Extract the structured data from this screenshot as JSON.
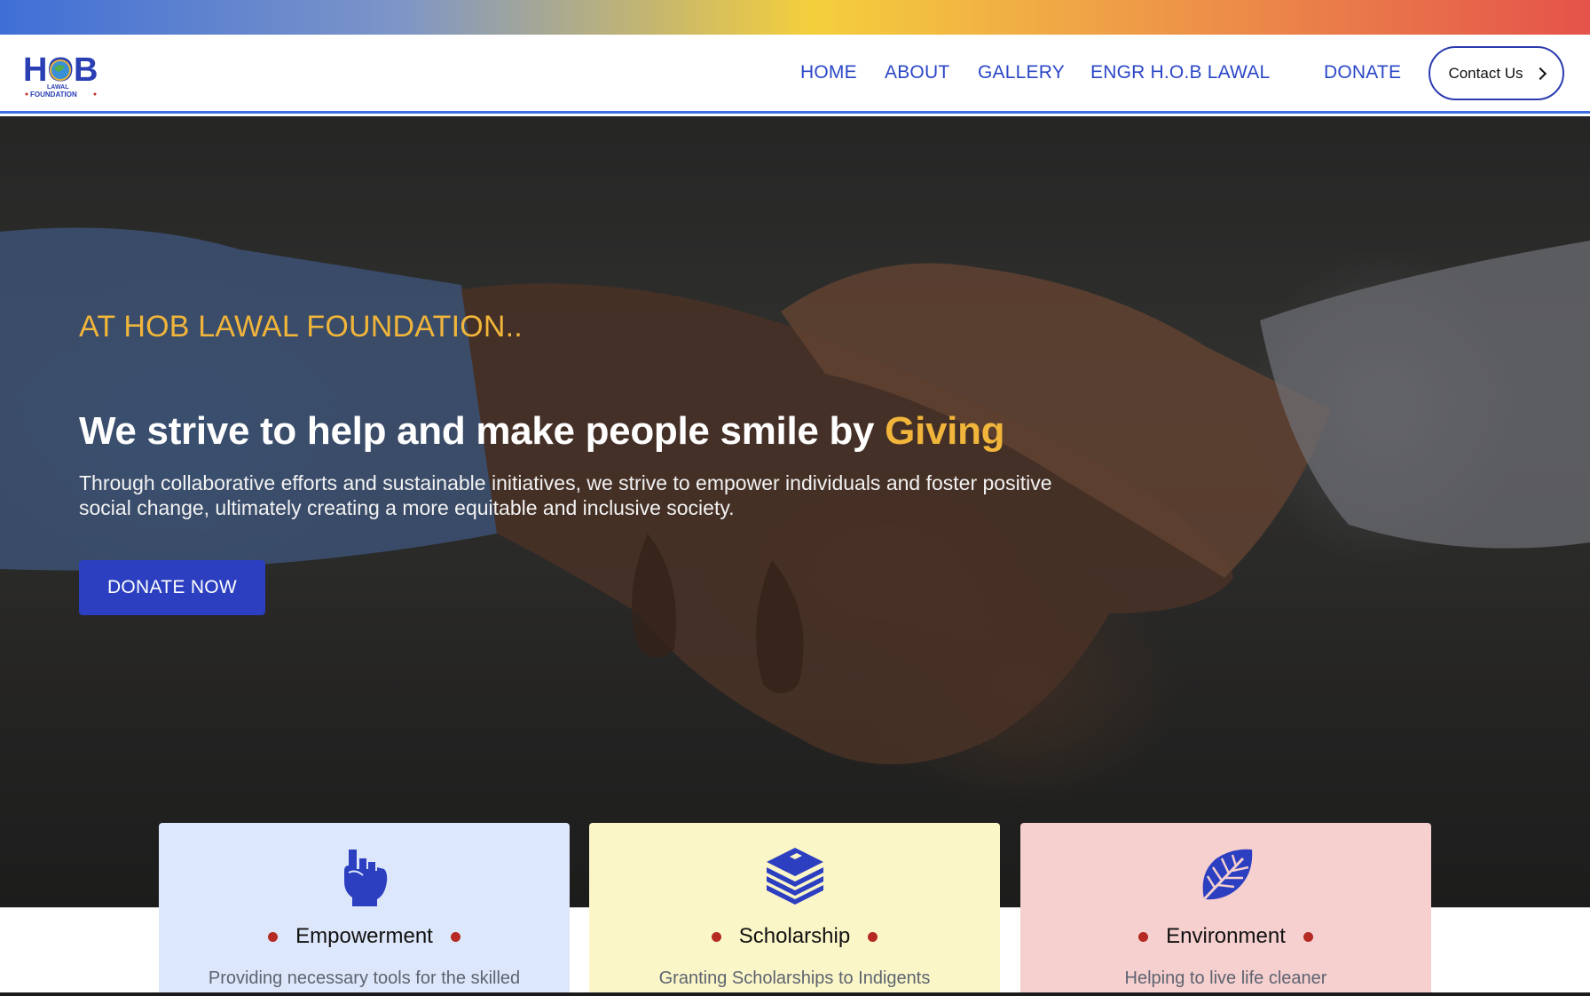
{
  "brand": {
    "logo_letters": "HOB",
    "logo_small": "LAWAL",
    "logo_sub": "FOUNDATION"
  },
  "nav": {
    "items": [
      {
        "label": "HOME"
      },
      {
        "label": "ABOUT"
      },
      {
        "label": "GALLERY"
      },
      {
        "label": "ENGR H.O.B LAWAL"
      },
      {
        "label": "DONATE"
      }
    ],
    "contact_label": "Contact Us",
    "contact_icon": "chevron-right-icon"
  },
  "hero": {
    "kicker": "AT HOB LAWAL FOUNDATION..",
    "headline_main": "We strive to help and make people smile by ",
    "headline_accent": "Giving",
    "subtext": "Through collaborative efforts and sustainable initiatives, we strive to empower individuals and foster positive social change, ultimately creating a more equitable and inclusive society.",
    "cta_label": "DONATE NOW",
    "background_image": "handshake-photo"
  },
  "cards": [
    {
      "title": "Empowerment",
      "description": "Providing necessary tools for the skilled",
      "icon": "raised-fist-icon",
      "bg": "#dde7fb"
    },
    {
      "title": "Scholarship",
      "description": "Granting Scholarships to Indigents",
      "icon": "book-stack-icon",
      "bg": "#fbf6c8"
    },
    {
      "title": "Environment",
      "description": "Helping to live life cleaner",
      "icon": "leaf-icon",
      "bg": "#f6cfcf"
    }
  ],
  "colors": {
    "primary_blue": "#2b3fc0",
    "nav_blue": "#2b47c7",
    "accent_gold": "#f0b53a",
    "bullet_red": "#b52a22"
  }
}
